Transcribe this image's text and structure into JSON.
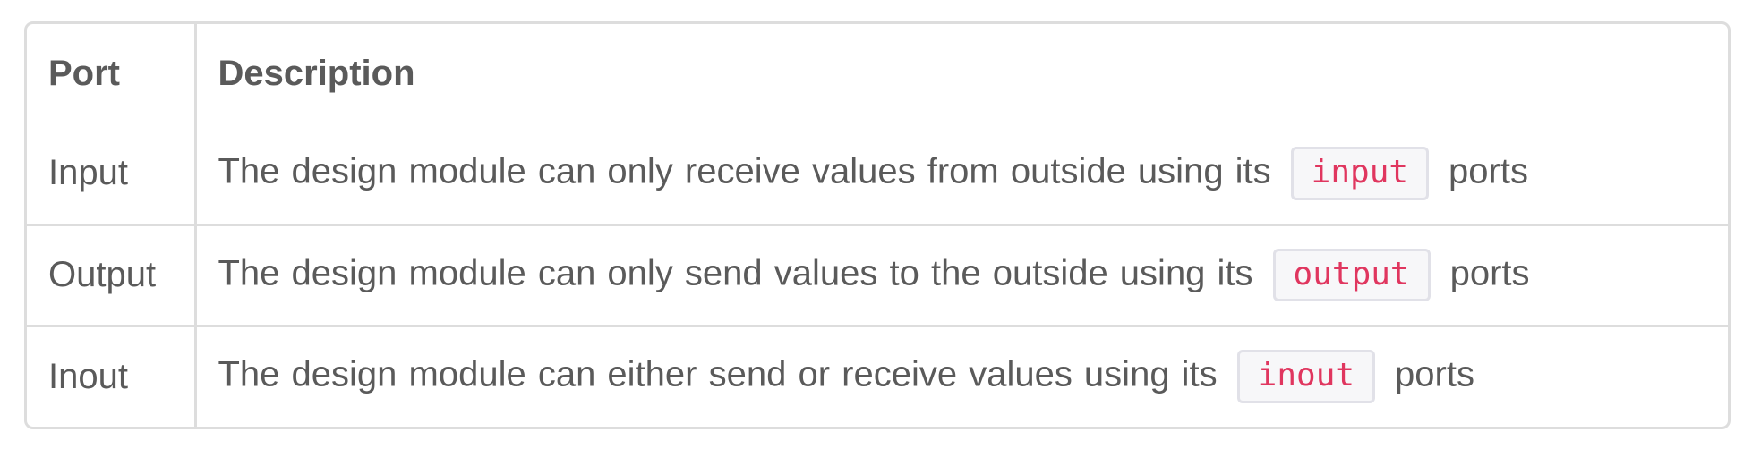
{
  "table": {
    "headers": {
      "port": "Port",
      "description": "Description"
    },
    "rows": [
      {
        "port": "Input",
        "before": "The design module can only receive values from outside using its",
        "code": "input",
        "after": "ports"
      },
      {
        "port": "Output",
        "before": "The design module can only send values to the outside using its",
        "code": "output",
        "after": "ports"
      },
      {
        "port": "Inout",
        "before": "The design module can either send or receive values using its",
        "code": "inout",
        "after": "ports"
      }
    ]
  },
  "colors": {
    "text": "#5a5a5a",
    "border": "#dddddd",
    "code_text": "#e0365f",
    "code_background": "#f7f7f9",
    "code_border": "#e1e1e8"
  }
}
